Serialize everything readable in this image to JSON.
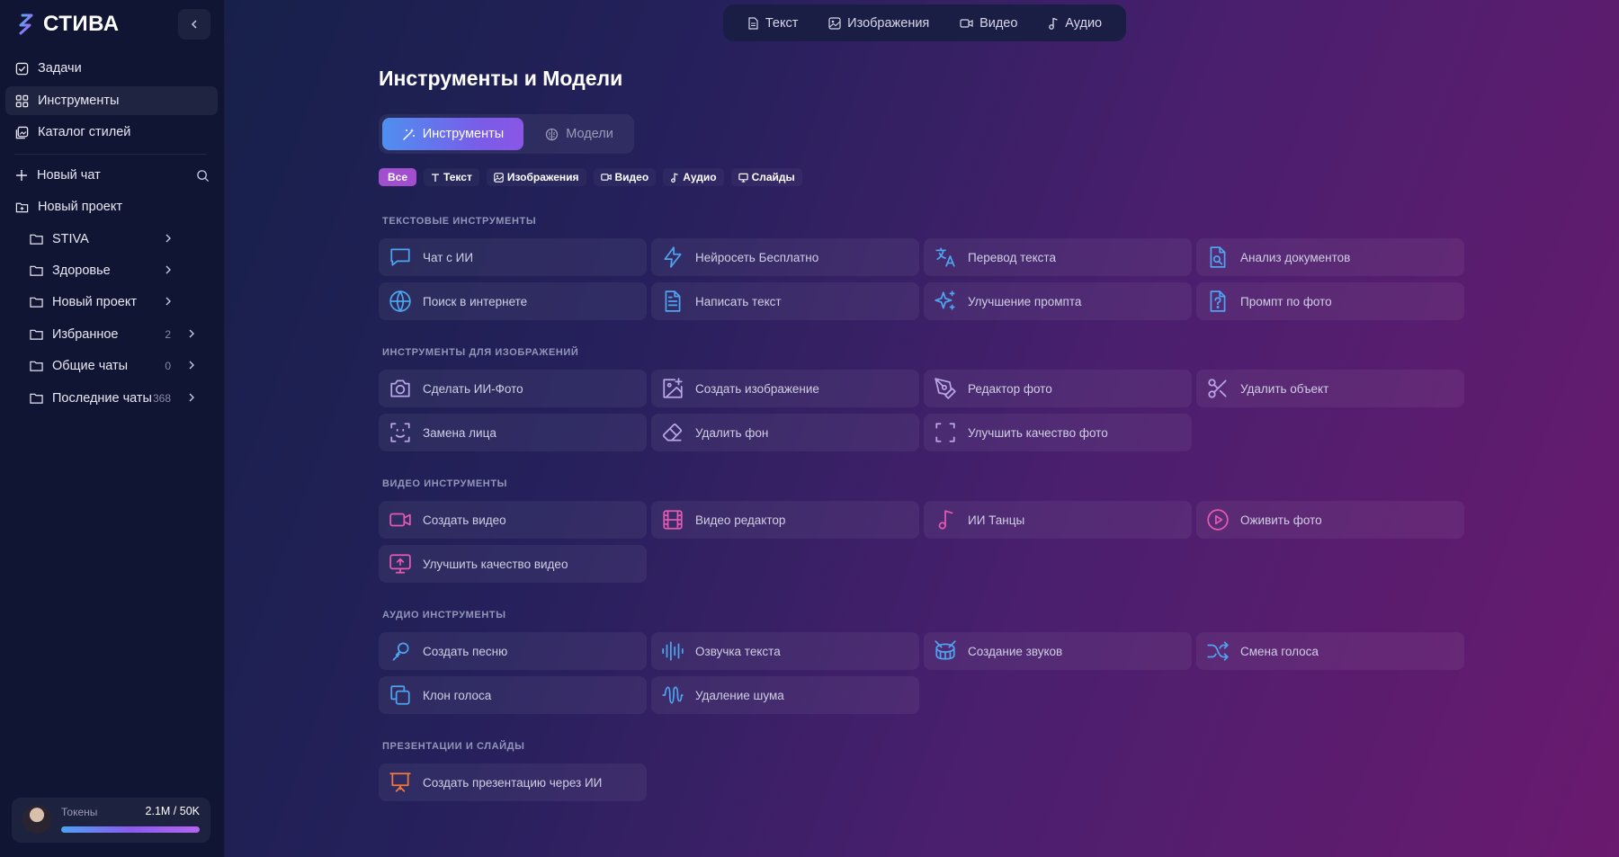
{
  "brand": {
    "name": "СТИВА"
  },
  "sidebar": {
    "nav": [
      {
        "label": "Задачи",
        "icon": "checkbox-icon"
      },
      {
        "label": "Инструменты",
        "icon": "grid-icon"
      },
      {
        "label": "Каталог стилей",
        "icon": "gallery-icon"
      }
    ],
    "new_chat": "Новый чат",
    "new_project": "Новый проект",
    "folders": [
      {
        "label": "STIVA",
        "count": ""
      },
      {
        "label": "Здоровье",
        "count": ""
      },
      {
        "label": "Новый проект",
        "count": ""
      },
      {
        "label": "Избранное",
        "count": "2"
      },
      {
        "label": "Общие чаты",
        "count": "0"
      },
      {
        "label": "Последние чаты",
        "count": "368"
      }
    ],
    "tokens": {
      "label": "Токены",
      "value": "2.1M / 50K",
      "fill_fraction": 1.0
    }
  },
  "topnav": [
    {
      "label": "Текст",
      "icon": "document-icon"
    },
    {
      "label": "Изображения",
      "icon": "image-icon"
    },
    {
      "label": "Видео",
      "icon": "video-icon"
    },
    {
      "label": "Аудио",
      "icon": "music-note-icon"
    }
  ],
  "main": {
    "title": "Инструменты и Модели",
    "segments": [
      {
        "label": "Инструменты",
        "icon": "magic-wand-icon",
        "active": true
      },
      {
        "label": "Модели",
        "icon": "brain-icon",
        "active": false
      }
    ],
    "filters": [
      {
        "label": "Все",
        "icon": ""
      },
      {
        "label": "Текст",
        "icon": "text-icon"
      },
      {
        "label": "Изображения",
        "icon": "image-icon"
      },
      {
        "label": "Видео",
        "icon": "video-icon"
      },
      {
        "label": "Аудио",
        "icon": "music-note-icon"
      },
      {
        "label": "Слайды",
        "icon": "slides-icon"
      }
    ],
    "sections": [
      {
        "title": "ТЕКСТОВЫЕ ИНСТРУМЕНТЫ",
        "color": "#4ea4ef",
        "tools": [
          {
            "label": "Чат с ИИ",
            "icon": "chat-bubble-icon"
          },
          {
            "label": "Нейросеть Бесплатно",
            "icon": "lightning-icon"
          },
          {
            "label": "Перевод текста",
            "icon": "translate-icon"
          },
          {
            "label": "Анализ документов",
            "icon": "document-search-icon"
          },
          {
            "label": "Поиск в интернете",
            "icon": "globe-icon"
          },
          {
            "label": "Написать текст",
            "icon": "document-text-icon"
          },
          {
            "label": "Улучшение промпта",
            "icon": "sparkles-icon"
          },
          {
            "label": "Промпт по фото",
            "icon": "question-document-icon"
          }
        ]
      },
      {
        "title": "ИНСТРУМЕНТЫ ДЛЯ ИЗОБРАЖЕНИЙ",
        "color": "#b9a6e6",
        "tools": [
          {
            "label": "Сделать ИИ-Фото",
            "icon": "camera-icon"
          },
          {
            "label": "Создать изображение",
            "icon": "image-plus-icon"
          },
          {
            "label": "Редактор фото",
            "icon": "pen-tool-icon"
          },
          {
            "label": "Удалить объект",
            "icon": "scissors-icon"
          },
          {
            "label": "Замена лица",
            "icon": "face-scan-icon"
          },
          {
            "label": "Удалить фон",
            "icon": "eraser-icon"
          },
          {
            "label": "Улучшить качество фото",
            "icon": "scan-frame-icon"
          }
        ]
      },
      {
        "title": "ВИДЕО ИНСТРУМЕНТЫ",
        "color": "#e45aaf",
        "tools": [
          {
            "label": "Создать видео",
            "icon": "video-camera-icon"
          },
          {
            "label": "Видео редактор",
            "icon": "film-icon"
          },
          {
            "label": "ИИ Танцы",
            "icon": "music-note-icon"
          },
          {
            "label": "Оживить фото",
            "icon": "play-circle-icon"
          },
          {
            "label": "Улучшить качество видео",
            "icon": "monitor-upload-icon"
          }
        ]
      },
      {
        "title": "АУДИО ИНСТРУМЕНТЫ",
        "color": "#4ea4ef",
        "tools": [
          {
            "label": "Создать песню",
            "icon": "microphone-icon"
          },
          {
            "label": "Озвучка текста",
            "icon": "audio-lines-icon"
          },
          {
            "label": "Создание звуков",
            "icon": "drum-icon"
          },
          {
            "label": "Смена голоса",
            "icon": "shuffle-icon"
          },
          {
            "label": "Клон голоса",
            "icon": "copy-icon"
          },
          {
            "label": "Удаление шума",
            "icon": "waveform-icon"
          }
        ]
      },
      {
        "title": "ПРЕЗЕНТАЦИИ И СЛАЙДЫ",
        "color": "#f07a3a",
        "tools": [
          {
            "label": "Создать презентацию через ИИ",
            "icon": "presentation-icon"
          }
        ]
      }
    ]
  }
}
